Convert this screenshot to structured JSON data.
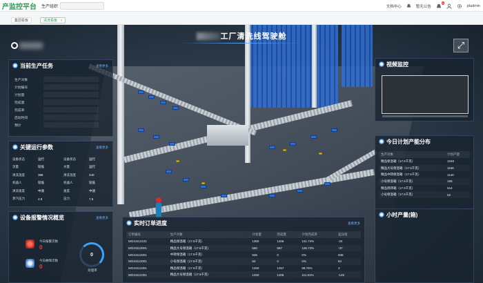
{
  "app": {
    "brand": "产监控平台",
    "org_label": "生产组织",
    "header_links": [
      "文档中心",
      "暂无公告"
    ],
    "notification_count": "5",
    "username": "jdadmin"
  },
  "tabs": [
    {
      "label": "集团看板",
      "active": false
    },
    {
      "label": "清洗看板",
      "active": true,
      "closable": "×"
    }
  ],
  "dashboard": {
    "title": "工厂清洗线驾驶舱"
  },
  "current_task": {
    "title": "当前生产任务",
    "more": "查看更多",
    "fields": [
      "生产对象",
      "计划编号",
      "计划量",
      "完成量",
      "完成率",
      "启动时间",
      "预计"
    ]
  },
  "key_params": {
    "title": "关键运行参数",
    "more": "查看更多",
    "rows": [
      [
        "设备状态",
        "运行",
        "设备状态",
        "运行"
      ],
      [
        "流量",
        "较低",
        "水量",
        "运行"
      ],
      [
        "清洗温度",
        "396",
        "清洗温度",
        "240"
      ],
      [
        "机器人",
        "较低",
        "机器人",
        "较低"
      ],
      [
        "清洗速度",
        "中速",
        "速度",
        "中速"
      ],
      [
        "蒸汽压力",
        "4.8",
        "压力",
        "7.5"
      ]
    ]
  },
  "alarms": {
    "title": "设备报警情况概览",
    "more": "查看更多",
    "today_alarm_label": "今日报警次数",
    "today_alarm_value": "0",
    "today_fault_label": "今日故障次数",
    "today_fault_value": "0",
    "gauge_value": "0",
    "gauge_label": "处理率"
  },
  "work_orders": {
    "title": "实时订单进度",
    "more": "查看更多",
    "columns": [
      "订单编号",
      "生产对象",
      "计划量",
      "完成量",
      "计划完成率",
      "差异值"
    ],
    "rows": [
      [
        "MO24112101",
        "精品保温箱（17.5千克）",
        "1380",
        "1406",
        "101.74%",
        "-24"
      ],
      [
        "MO24112001",
        "精品大号保温箱（17.5千克）",
        "550",
        "587",
        "106.73%",
        "-37"
      ],
      [
        "MO24112001",
        "中转保温箱（17.5千克）",
        "936",
        "0",
        "0%",
        "936"
      ],
      [
        "MO24112001",
        "小号保温箱（17.5千克）",
        "84",
        "0",
        "0%",
        "84"
      ],
      [
        "MO24112301",
        "精品保温箱（17.5千克）",
        "1260",
        "1257",
        "99.76%",
        "3"
      ],
      [
        "MO24112301",
        "精品大号保温箱（17.5千克）",
        "1260",
        "1405",
        "111.51%",
        "-145"
      ]
    ]
  },
  "video": {
    "title": "视频监控"
  },
  "capacity": {
    "title": "今日计划产能分布",
    "columns": [
      "生产对象",
      "计划产量"
    ],
    "rows": [
      [
        "精品保温箱（17.5千克）",
        "1040"
      ],
      [
        "精品大号保温箱（17.5千克）",
        "1166"
      ],
      [
        "精品中转保温箱（17.5千克）",
        "1140"
      ],
      [
        "小号保温箱（17.5千克）",
        "165"
      ],
      [
        "精品周转箱（17.5千克）",
        "514"
      ],
      [
        "小号保温箱（17.5千克）",
        "52"
      ]
    ]
  },
  "hourly": {
    "title": "小时产量(箱)"
  }
}
